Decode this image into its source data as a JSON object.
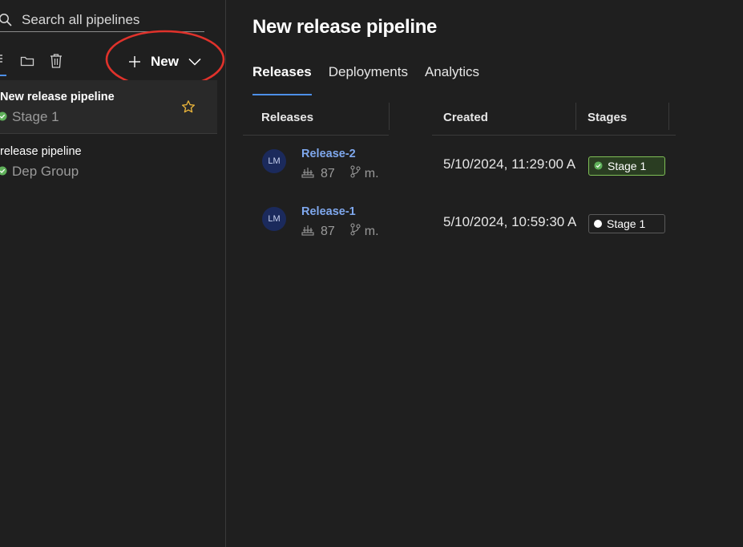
{
  "sidebar": {
    "search_placeholder": "Search all pipelines",
    "new_button_label": "New",
    "pipelines": [
      {
        "name": "New release pipeline",
        "sub": "Stage 1",
        "status": "succeeded",
        "favorite": true
      },
      {
        "name": "release pipeline",
        "sub": "Dep Group",
        "status": "succeeded",
        "favorite": false
      }
    ]
  },
  "main": {
    "title": "New release pipeline",
    "tabs": [
      {
        "label": "Releases",
        "active": true
      },
      {
        "label": "Deployments",
        "active": false
      },
      {
        "label": "Analytics",
        "active": false
      }
    ],
    "columns": [
      "Releases",
      "Created",
      "Stages"
    ],
    "releases": [
      {
        "avatar": "LM",
        "name": "Release-2",
        "build": "87",
        "branch": "m.",
        "created": "5/10/2024, 11:29:00 A",
        "stage": "Stage 1",
        "stage_status": "succeeded"
      },
      {
        "avatar": "LM",
        "name": "Release-1",
        "build": "87",
        "branch": "m.",
        "created": "5/10/2024, 10:59:30 A",
        "stage": "Stage 1",
        "stage_status": "not-deployed"
      }
    ]
  },
  "colors": {
    "accent": "#4d8fe8",
    "link": "#7fa8ee",
    "success": "#5fb05a",
    "annotation": "#e0322b",
    "star": "#e8b33a"
  }
}
